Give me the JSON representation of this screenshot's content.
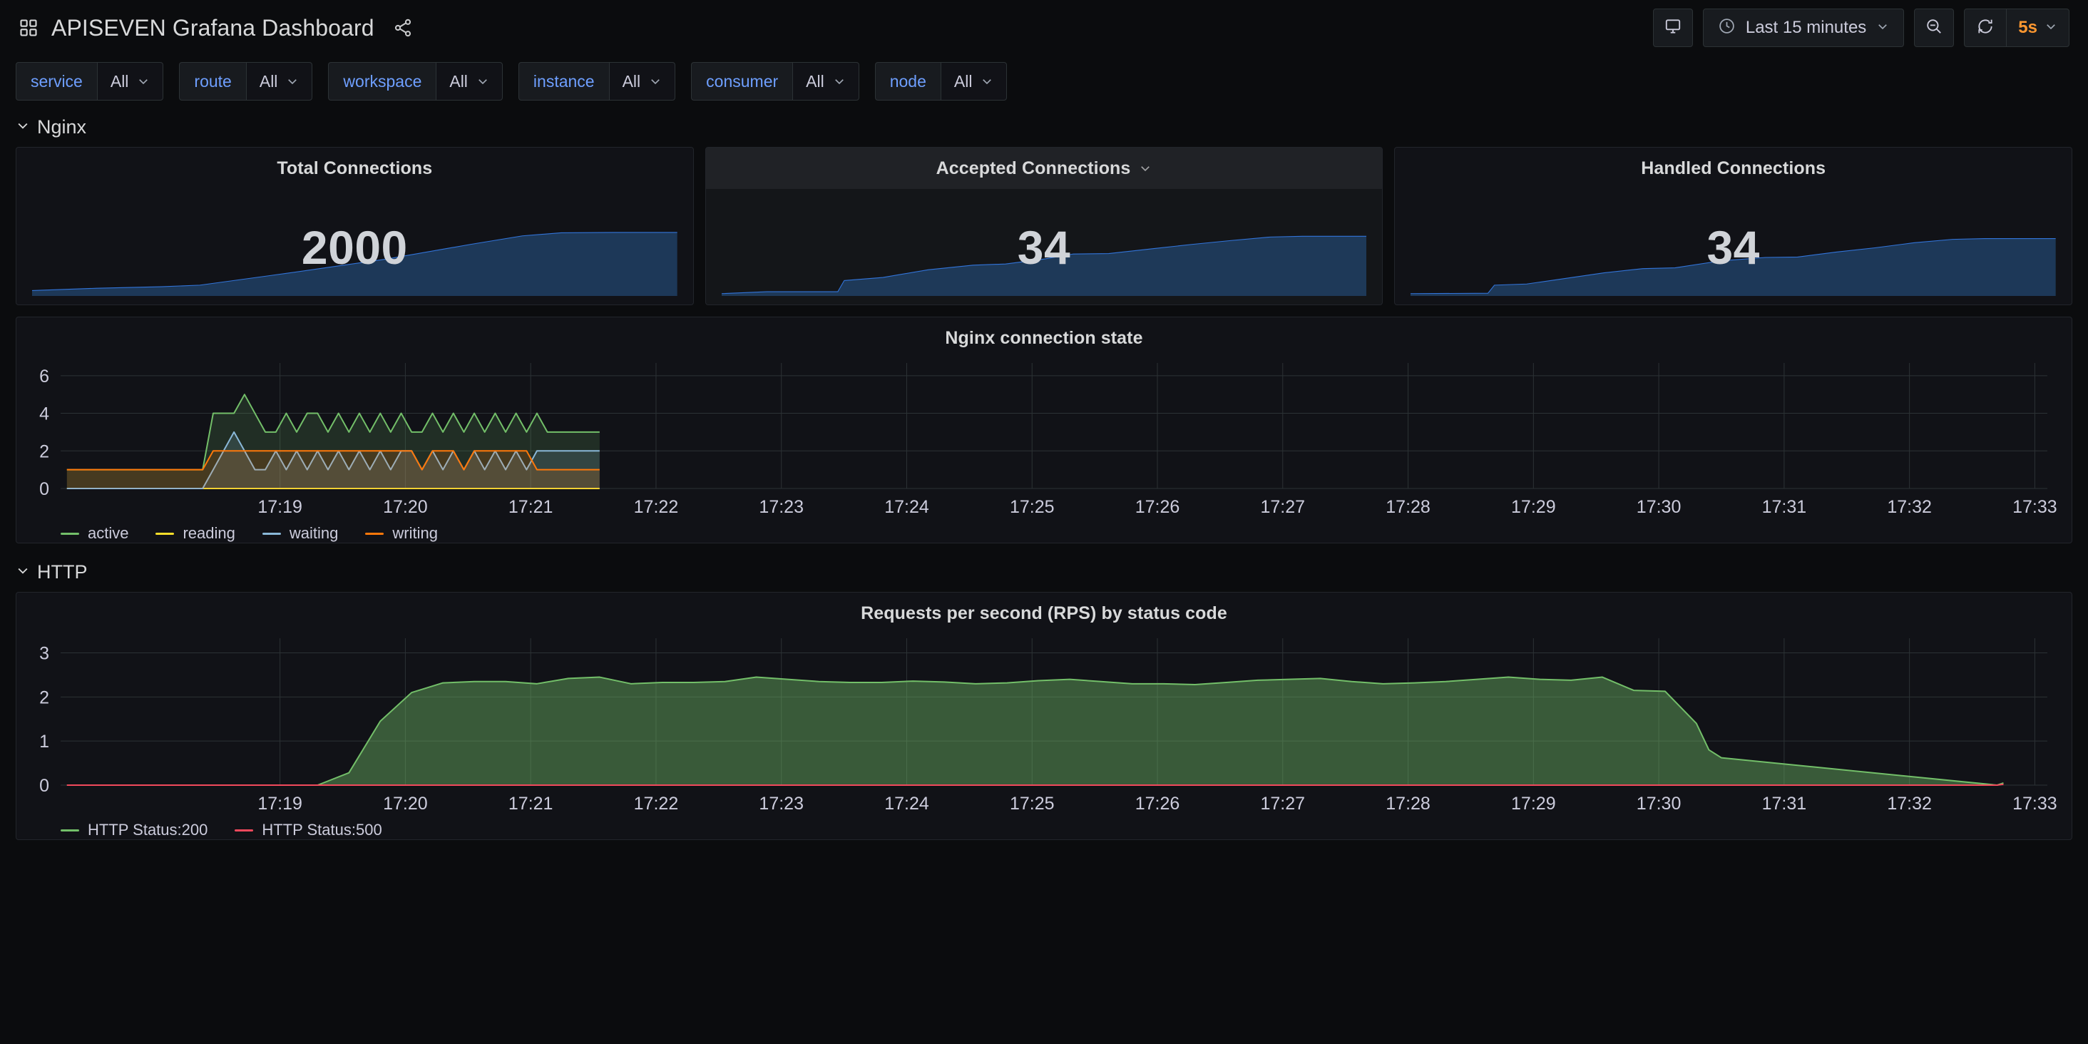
{
  "header": {
    "title": "APISEVEN Grafana Dashboard",
    "grid_icon": "grid-icon",
    "share_icon": "share-icon",
    "tv_icon": "tv-mode-icon",
    "clock_icon": "clock-icon",
    "zoom_out_icon": "zoom-out-icon",
    "refresh_icon": "refresh-icon",
    "time_range": "Last 15 minutes",
    "refresh_interval": "5s"
  },
  "variables": [
    {
      "label": "service",
      "value": "All"
    },
    {
      "label": "route",
      "value": "All"
    },
    {
      "label": "workspace",
      "value": "All"
    },
    {
      "label": "instance",
      "value": "All"
    },
    {
      "label": "consumer",
      "value": "All"
    },
    {
      "label": "node",
      "value": "All"
    }
  ],
  "sections": [
    {
      "title": "Nginx"
    },
    {
      "title": "HTTP"
    }
  ],
  "stats": [
    {
      "title": "Total Connections",
      "value": "2000",
      "hovered": false
    },
    {
      "title": "Accepted Connections",
      "value": "34",
      "hovered": true
    },
    {
      "title": "Handled Connections",
      "value": "34",
      "hovered": false
    }
  ],
  "colors": {
    "accent_blue": "#6e9fff",
    "spark_line": "#3274d9",
    "spark_fill": "#1f3b5c",
    "orange": "#ff9830",
    "green": "#73bf69",
    "yellow": "#fade2a",
    "cyan": "#8ab8d8",
    "writing_orange": "#ff780a",
    "red": "#f2495c",
    "grid": "#2c3235",
    "axis_text": "#ccccdc"
  },
  "chart_data": [
    {
      "id": "nginx-connection-state",
      "type": "line",
      "title": "Nginx connection state",
      "xlabel": "",
      "ylabel": "",
      "ylim": [
        0,
        6.6
      ],
      "yticks": [
        0,
        2,
        4,
        6
      ],
      "grid": true,
      "legend_position": "bottom",
      "xticks": [
        "17:19",
        "17:20",
        "17:21",
        "17:22",
        "17:23",
        "17:24",
        "17:25",
        "17:26",
        "17:27",
        "17:28",
        "17:29",
        "17:30",
        "17:31",
        "17:32",
        "17:33"
      ],
      "x": [
        17.3,
        17.383,
        17.467,
        17.55,
        17.633,
        17.717,
        17.8,
        17.883,
        17.967,
        18.05,
        18.133,
        18.217,
        18.3,
        18.383,
        18.467,
        18.55,
        18.633,
        18.717,
        18.8,
        18.883,
        18.967,
        19.05,
        19.133,
        19.217,
        19.3,
        19.383,
        19.467,
        19.55,
        19.633,
        19.717,
        19.8,
        19.883,
        19.967,
        20.05,
        20.133,
        20.217,
        20.3,
        20.383,
        20.467,
        20.55,
        20.633,
        20.717,
        20.8,
        20.883,
        20.967,
        21.05,
        21.133,
        21.217,
        21.3,
        21.383,
        21.467,
        21.55
      ],
      "series": [
        {
          "name": "active",
          "color": "#73bf69",
          "values": [
            1,
            1,
            1,
            1,
            1,
            1,
            1,
            1,
            1,
            1,
            1,
            1,
            1,
            1,
            4,
            4,
            4,
            5,
            4,
            3,
            3,
            4,
            3,
            4,
            4,
            3,
            4,
            3,
            4,
            3,
            4,
            3,
            4,
            3,
            3,
            4,
            3,
            4,
            3,
            4,
            3,
            4,
            3,
            4,
            3,
            4,
            3,
            3,
            3,
            3,
            3,
            3
          ]
        },
        {
          "name": "reading",
          "color": "#fade2a",
          "values": [
            0,
            0,
            0,
            0,
            0,
            0,
            0,
            0,
            0,
            0,
            0,
            0,
            0,
            0,
            0,
            0,
            0,
            0,
            0,
            0,
            0,
            0,
            0,
            0,
            0,
            0,
            0,
            0,
            0,
            0,
            0,
            0,
            0,
            0,
            0,
            0,
            0,
            0,
            0,
            0,
            0,
            0,
            0,
            0,
            0,
            0,
            0,
            0,
            0,
            0,
            0,
            0
          ]
        },
        {
          "name": "waiting",
          "color": "#8ab8d8",
          "values": [
            0,
            0,
            0,
            0,
            0,
            0,
            0,
            0,
            0,
            0,
            0,
            0,
            0,
            0,
            1,
            2,
            3,
            2,
            1,
            1,
            2,
            1,
            2,
            1,
            2,
            1,
            2,
            1,
            2,
            1,
            2,
            1,
            2,
            2,
            1,
            2,
            1,
            2,
            1,
            2,
            1,
            2,
            1,
            2,
            1,
            2,
            2,
            2,
            2,
            2,
            2,
            2
          ]
        },
        {
          "name": "writing",
          "color": "#ff780a",
          "values": [
            1,
            1,
            1,
            1,
            1,
            1,
            1,
            1,
            1,
            1,
            1,
            1,
            1,
            1,
            2,
            2,
            2,
            2,
            2,
            2,
            2,
            2,
            2,
            2,
            2,
            2,
            2,
            2,
            2,
            2,
            2,
            2,
            2,
            2,
            1,
            2,
            2,
            2,
            1,
            2,
            2,
            2,
            2,
            2,
            2,
            1,
            1,
            1,
            1,
            1,
            1,
            1
          ]
        }
      ]
    },
    {
      "id": "rps-by-status-code",
      "type": "area",
      "title": "Requests per second (RPS) by status code",
      "xlabel": "",
      "ylabel": "",
      "ylim": [
        0,
        3.3
      ],
      "yticks": [
        0,
        1,
        2,
        3
      ],
      "grid": true,
      "legend_position": "bottom",
      "xticks": [
        "17:19",
        "17:20",
        "17:21",
        "17:22",
        "17:23",
        "17:24",
        "17:25",
        "17:26",
        "17:27",
        "17:28",
        "17:29",
        "17:30",
        "17:31",
        "17:32",
        "17:33"
      ],
      "x": [
        17.3,
        17.55,
        17.8,
        18.05,
        18.3,
        18.55,
        18.8,
        19.05,
        19.3,
        19.55,
        19.8,
        20.05,
        20.3,
        20.55,
        20.8,
        21.05,
        21.3,
        21.55,
        21.8,
        22.05,
        22.3,
        22.55,
        22.8,
        23.05,
        23.3,
        23.55,
        23.8,
        24.05,
        24.3,
        24.55,
        24.8,
        25.05,
        25.3,
        25.55,
        25.8,
        26.05,
        26.3,
        26.55,
        26.8,
        27.05,
        27.3,
        27.55,
        27.8,
        28.05,
        28.3,
        28.55,
        28.8,
        29.05,
        29.3,
        29.55,
        29.8,
        30.05,
        30.3,
        30.4,
        30.5,
        32.7,
        32.75
      ],
      "series": [
        {
          "name": "HTTP Status:200",
          "color": "#73bf69",
          "values": [
            0,
            0,
            0,
            0,
            0,
            0,
            0,
            0,
            0,
            0.28,
            1.45,
            2.1,
            2.32,
            2.35,
            2.35,
            2.3,
            2.42,
            2.45,
            2.3,
            2.33,
            2.33,
            2.35,
            2.45,
            2.4,
            2.35,
            2.33,
            2.33,
            2.36,
            2.34,
            2.3,
            2.32,
            2.37,
            2.4,
            2.35,
            2.3,
            2.3,
            2.28,
            2.33,
            2.38,
            2.4,
            2.42,
            2.35,
            2.3,
            2.32,
            2.35,
            2.4,
            2.45,
            2.4,
            2.38,
            2.45,
            2.15,
            2.13,
            1.4,
            0.8,
            0.62,
            0,
            0.05
          ]
        },
        {
          "name": "HTTP Status:500",
          "color": "#f2495c",
          "values": [
            0,
            0,
            0,
            0,
            0,
            0,
            0,
            0,
            0,
            0,
            0,
            0,
            0,
            0,
            0,
            0,
            0,
            0,
            0,
            0,
            0,
            0,
            0,
            0,
            0,
            0,
            0,
            0,
            0,
            0,
            0,
            0,
            0,
            0,
            0,
            0,
            0,
            0,
            0,
            0,
            0,
            0,
            0,
            0,
            0,
            0,
            0,
            0,
            0,
            0,
            0,
            0,
            0,
            0,
            0,
            0,
            0.02
          ]
        }
      ]
    }
  ]
}
